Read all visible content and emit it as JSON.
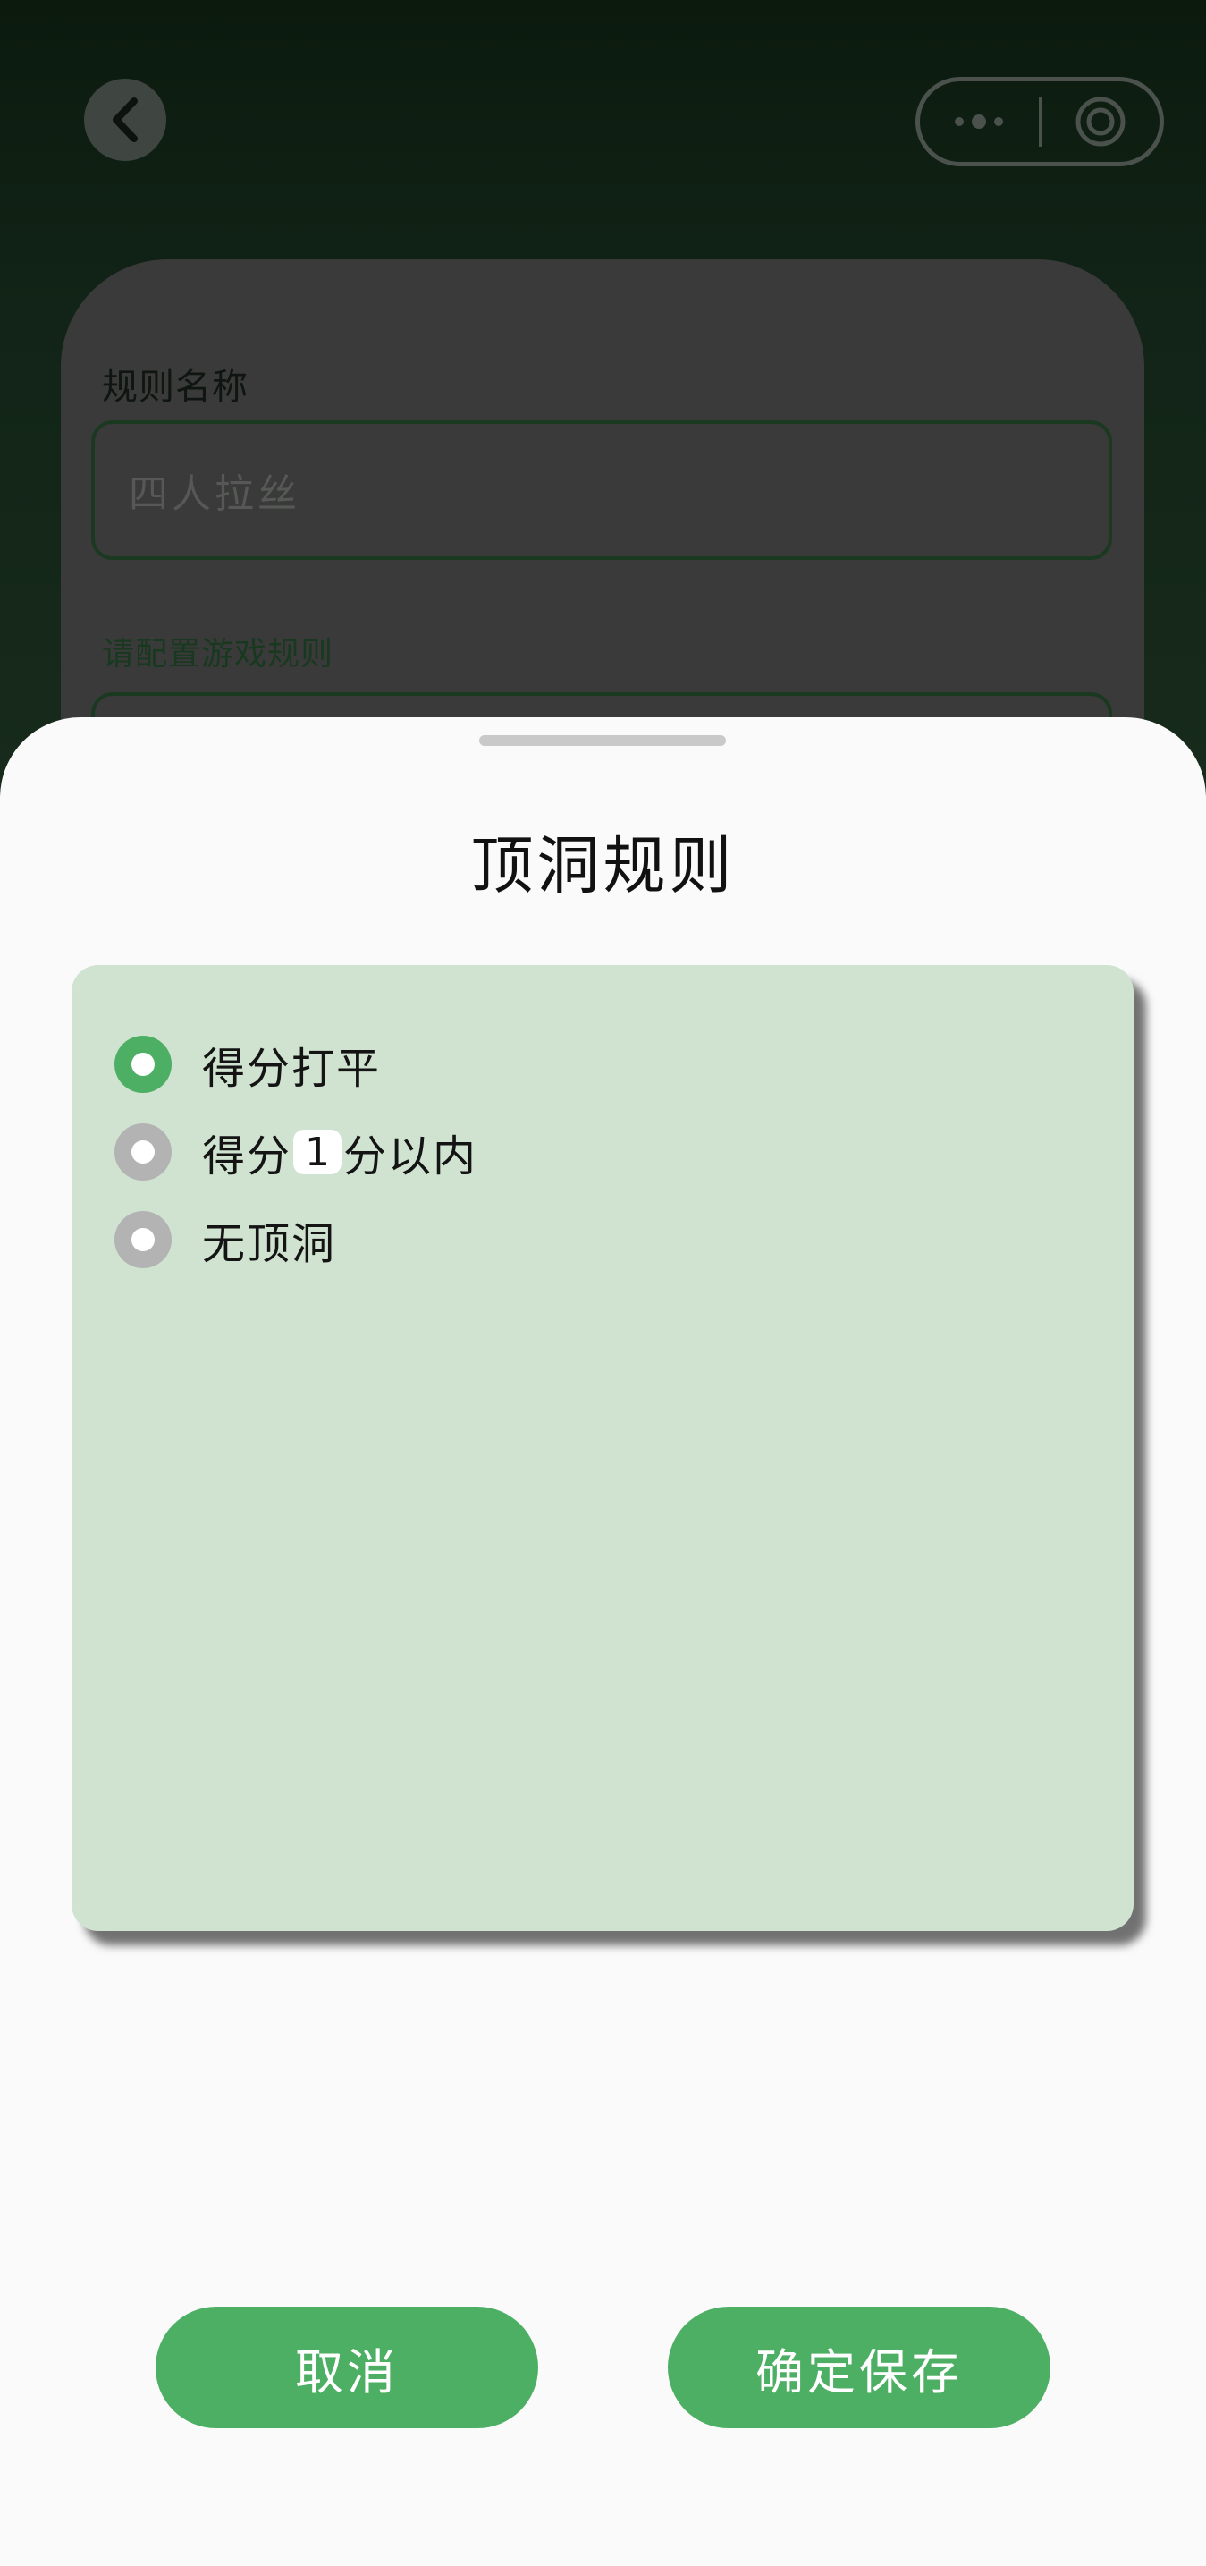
{
  "colors": {
    "accent": "#4caf63",
    "radio_unselected": "#b3b3b3",
    "panel_bg": "#cfe3d0",
    "sheet_bg": "#fafafa"
  },
  "header": {
    "back_icon": "chevron-left-icon",
    "capsule_more_icon": "more-dots-icon",
    "capsule_close_icon": "target-circle-icon"
  },
  "form": {
    "rule_name_label": "规则名称",
    "rule_name_placeholder": "四人拉丝",
    "config_label": "请配置游戏规则"
  },
  "sheet": {
    "title": "顶洞规则",
    "options": [
      {
        "label": "得分打平",
        "selected": true
      },
      {
        "label_prefix": "得分",
        "value": "1",
        "label_suffix": "分以内",
        "selected": false
      },
      {
        "label": "无顶洞",
        "selected": false
      }
    ],
    "cancel_label": "取消",
    "confirm_label": "确定保存"
  }
}
